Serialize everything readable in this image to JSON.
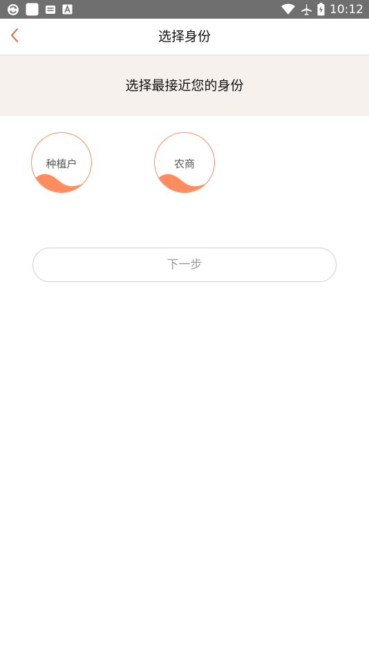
{
  "status_bar": {
    "time": "10:12",
    "left_icons": [
      "sync-icon",
      "app-square-icon",
      "mail-icon",
      "font-a-icon"
    ],
    "right_icons": [
      "wifi-icon",
      "airplane-mode-icon",
      "battery-icon"
    ]
  },
  "header": {
    "back_icon": "chevron-left-icon",
    "title": "选择身份"
  },
  "banner": {
    "text": "选择最接近您的身份"
  },
  "roles": [
    {
      "label": "种植户"
    },
    {
      "label": "农商"
    }
  ],
  "next_button": {
    "label": "下一步"
  },
  "colors": {
    "accent": "#ff8c5f",
    "back_arrow": "#e8652f",
    "banner_bg": "#f6f1ec",
    "status_bar_bg": "#6f6f6f"
  }
}
